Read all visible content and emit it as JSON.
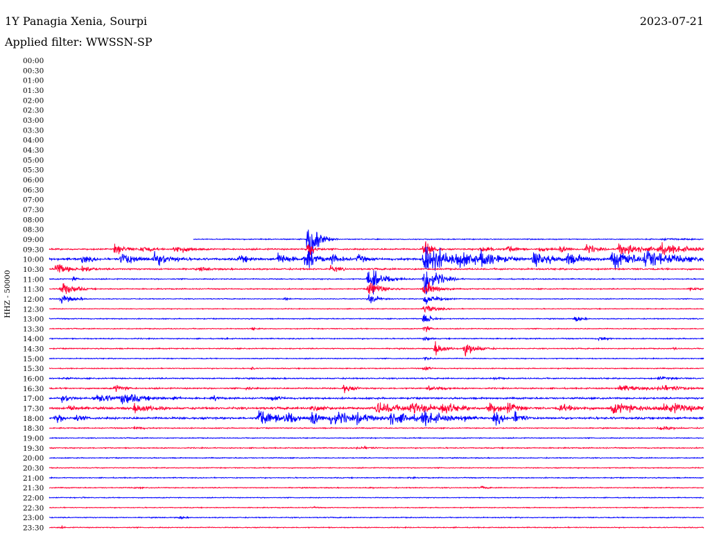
{
  "header": {
    "station": "1Y Panagia Xenia, Sourpi",
    "date": "2023-07-21",
    "filter": "Applied filter: WWSSN-SP"
  },
  "chart_data": {
    "type": "line",
    "subtype": "helicorder",
    "title": "1Y Panagia Xenia, Sourpi",
    "date": "2023-07-21",
    "filter": "WWSSN-SP",
    "ylabel": "HHZ - 50000",
    "xlabel": "",
    "row_labels": [
      "00:00",
      "00:30",
      "01:00",
      "01:30",
      "02:00",
      "02:30",
      "03:00",
      "03:30",
      "04:00",
      "04:30",
      "05:00",
      "05:30",
      "06:00",
      "06:30",
      "07:00",
      "07:30",
      "08:00",
      "08:30",
      "09:00",
      "09:30",
      "10:00",
      "10:30",
      "11:00",
      "11:30",
      "12:00",
      "12:30",
      "13:00",
      "13:30",
      "14:00",
      "14:30",
      "15:00",
      "15:30",
      "16:00",
      "16:30",
      "17:00",
      "17:30",
      "18:00",
      "18:30",
      "19:00",
      "19:30",
      "20:00",
      "20:30",
      "21:00",
      "21:30",
      "22:00",
      "22:30",
      "23:00",
      "23:30"
    ],
    "row_minutes": 30,
    "trace_colors": [
      "#0000ff",
      "#ff0033"
    ],
    "data_start_fraction": 0.22,
    "rows": [
      {
        "t": "09:00",
        "start": 0.22,
        "noise": 0.9,
        "events": [
          {
            "x": 0.396,
            "a": 60,
            "w": 0.012,
            "sym": false
          },
          {
            "x": 0.936,
            "a": 3,
            "w": 0.03
          },
          {
            "x": 0.97,
            "a": 2,
            "w": 0.03
          }
        ]
      },
      {
        "t": "09:30",
        "noise": 1.4,
        "events": [
          {
            "x": 0.1,
            "a": 12,
            "w": 0.018
          },
          {
            "x": 0.14,
            "a": 8,
            "w": 0.02
          },
          {
            "x": 0.19,
            "a": 9,
            "w": 0.03
          },
          {
            "x": 0.396,
            "a": 22,
            "w": 0.01
          },
          {
            "x": 0.573,
            "a": 22,
            "w": 0.012
          },
          {
            "x": 0.66,
            "a": 9,
            "w": 0.02
          },
          {
            "x": 0.7,
            "a": 8,
            "w": 0.02
          },
          {
            "x": 0.75,
            "a": 6,
            "w": 0.02
          },
          {
            "x": 0.78,
            "a": 7,
            "w": 0.02
          },
          {
            "x": 0.82,
            "a": 10,
            "w": 0.02
          },
          {
            "x": 0.87,
            "a": 14,
            "w": 0.04
          },
          {
            "x": 0.93,
            "a": 12,
            "w": 0.05
          }
        ]
      },
      {
        "t": "10:00",
        "noise": 2,
        "events": [
          {
            "x": 0.05,
            "a": 10,
            "w": 0.02
          },
          {
            "x": 0.11,
            "a": 14,
            "w": 0.03
          },
          {
            "x": 0.16,
            "a": 14,
            "w": 0.035
          },
          {
            "x": 0.29,
            "a": 10,
            "w": 0.02
          },
          {
            "x": 0.35,
            "a": 15,
            "w": 0.02
          },
          {
            "x": 0.39,
            "a": 20,
            "w": 0.02
          },
          {
            "x": 0.43,
            "a": 12,
            "w": 0.02
          },
          {
            "x": 0.47,
            "a": 10,
            "w": 0.02
          },
          {
            "x": 0.573,
            "a": 40,
            "w": 0.03
          },
          {
            "x": 0.62,
            "a": 20,
            "w": 0.04
          },
          {
            "x": 0.66,
            "a": 22,
            "w": 0.03
          },
          {
            "x": 0.74,
            "a": 18,
            "w": 0.03
          },
          {
            "x": 0.79,
            "a": 15,
            "w": 0.03
          },
          {
            "x": 0.86,
            "a": 20,
            "w": 0.04
          },
          {
            "x": 0.91,
            "a": 22,
            "w": 0.05
          }
        ]
      },
      {
        "t": "10:30",
        "noise": 1.5,
        "events": [
          {
            "x": 0.01,
            "a": 14,
            "w": 0.02
          },
          {
            "x": 0.05,
            "a": 8,
            "w": 0.02
          },
          {
            "x": 0.23,
            "a": 4,
            "w": 0.03
          },
          {
            "x": 0.43,
            "a": 7,
            "w": 0.02
          }
        ]
      },
      {
        "t": "11:00",
        "noise": 1,
        "events": [
          {
            "x": 0.037,
            "a": 5,
            "w": 0.01
          },
          {
            "x": 0.488,
            "a": 30,
            "w": 0.02,
            "sym": false
          },
          {
            "x": 0.573,
            "a": 30,
            "w": 0.02,
            "sym": false
          }
        ]
      },
      {
        "t": "11:30",
        "noise": 1,
        "events": [
          {
            "x": 0.018,
            "a": 16,
            "w": 0.02,
            "sym": false
          },
          {
            "x": 0.488,
            "a": 16,
            "w": 0.02
          },
          {
            "x": 0.573,
            "a": 16,
            "w": 0.02
          },
          {
            "x": 0.98,
            "a": 6,
            "w": 0.01
          }
        ]
      },
      {
        "t": "12:00",
        "noise": 0.8,
        "events": [
          {
            "x": 0.018,
            "a": 10,
            "w": 0.02
          },
          {
            "x": 0.36,
            "a": 5,
            "w": 0.006
          },
          {
            "x": 0.488,
            "a": 12,
            "w": 0.015
          },
          {
            "x": 0.573,
            "a": 14,
            "w": 0.02
          }
        ]
      },
      {
        "t": "12:30",
        "noise": 0.8,
        "events": [
          {
            "x": 0.573,
            "a": 10,
            "w": 0.02
          }
        ]
      },
      {
        "t": "13:00",
        "noise": 0.9,
        "events": [
          {
            "x": 0.573,
            "a": 16,
            "w": 0.01
          },
          {
            "x": 0.804,
            "a": 7,
            "w": 0.012
          }
        ]
      },
      {
        "t": "13:30",
        "noise": 0.9,
        "events": [
          {
            "x": 0.31,
            "a": 4,
            "w": 0.01
          },
          {
            "x": 0.573,
            "a": 8,
            "w": 0.01
          }
        ]
      },
      {
        "t": "14:00",
        "noise": 1,
        "events": [
          {
            "x": 0.27,
            "a": 3,
            "w": 0.008
          },
          {
            "x": 0.573,
            "a": 6,
            "w": 0.01
          },
          {
            "x": 0.84,
            "a": 5,
            "w": 0.015
          }
        ]
      },
      {
        "t": "14:30",
        "noise": 1,
        "events": [
          {
            "x": 0.59,
            "a": 14,
            "w": 0.015
          },
          {
            "x": 0.635,
            "a": 14,
            "w": 0.02
          },
          {
            "x": 0.955,
            "a": 4,
            "w": 0.005
          }
        ]
      },
      {
        "t": "15:00",
        "noise": 0.9,
        "events": [
          {
            "x": 0.573,
            "a": 6,
            "w": 0.01
          }
        ]
      },
      {
        "t": "15:30",
        "noise": 0.9,
        "events": [
          {
            "x": 0.31,
            "a": 5,
            "w": 0.005
          },
          {
            "x": 0.573,
            "a": 6,
            "w": 0.01
          }
        ]
      },
      {
        "t": "16:00",
        "noise": 1.2,
        "events": [
          {
            "x": 0.02,
            "a": 3,
            "w": 0.02
          },
          {
            "x": 0.68,
            "a": 3,
            "w": 0.02
          },
          {
            "x": 0.93,
            "a": 4,
            "w": 0.04
          }
        ]
      },
      {
        "t": "16:30",
        "noise": 1.3,
        "events": [
          {
            "x": 0.1,
            "a": 8,
            "w": 0.02
          },
          {
            "x": 0.3,
            "a": 4,
            "w": 0.02
          },
          {
            "x": 0.45,
            "a": 11,
            "w": 0.015
          },
          {
            "x": 0.58,
            "a": 6,
            "w": 0.03
          },
          {
            "x": 0.87,
            "a": 8,
            "w": 0.04
          },
          {
            "x": 0.93,
            "a": 7,
            "w": 0.05
          }
        ]
      },
      {
        "t": "17:00",
        "noise": 1.6,
        "events": [
          {
            "x": 0.02,
            "a": 9,
            "w": 0.02
          },
          {
            "x": 0.07,
            "a": 12,
            "w": 0.03
          },
          {
            "x": 0.11,
            "a": 14,
            "w": 0.035
          },
          {
            "x": 0.19,
            "a": 6,
            "w": 0.012
          },
          {
            "x": 0.25,
            "a": 7,
            "w": 0.012
          },
          {
            "x": 0.34,
            "a": 6,
            "w": 0.02
          }
        ]
      },
      {
        "t": "17:30",
        "noise": 2,
        "events": [
          {
            "x": 0.03,
            "a": 7,
            "w": 0.03
          },
          {
            "x": 0.13,
            "a": 10,
            "w": 0.04
          },
          {
            "x": 0.4,
            "a": 8,
            "w": 0.03
          },
          {
            "x": 0.5,
            "a": 14,
            "w": 0.04
          },
          {
            "x": 0.55,
            "a": 16,
            "w": 0.04
          },
          {
            "x": 0.6,
            "a": 14,
            "w": 0.03
          },
          {
            "x": 0.67,
            "a": 16,
            "w": 0.02
          },
          {
            "x": 0.7,
            "a": 14,
            "w": 0.02
          },
          {
            "x": 0.78,
            "a": 8,
            "w": 0.04
          },
          {
            "x": 0.86,
            "a": 12,
            "w": 0.06
          },
          {
            "x": 0.94,
            "a": 12,
            "w": 0.06
          }
        ]
      },
      {
        "t": "18:00",
        "noise": 2,
        "events": [
          {
            "x": 0.01,
            "a": 10,
            "w": 0.02
          },
          {
            "x": 0.04,
            "a": 8,
            "w": 0.02
          },
          {
            "x": 0.32,
            "a": 20,
            "w": 0.03
          },
          {
            "x": 0.36,
            "a": 18,
            "w": 0.02
          },
          {
            "x": 0.4,
            "a": 16,
            "w": 0.02
          },
          {
            "x": 0.43,
            "a": 18,
            "w": 0.03
          },
          {
            "x": 0.47,
            "a": 14,
            "w": 0.03
          },
          {
            "x": 0.52,
            "a": 16,
            "w": 0.04
          },
          {
            "x": 0.57,
            "a": 16,
            "w": 0.04
          },
          {
            "x": 0.63,
            "a": 10,
            "w": 0.02
          },
          {
            "x": 0.68,
            "a": 18,
            "w": 0.015
          },
          {
            "x": 0.71,
            "a": 14,
            "w": 0.015
          }
        ]
      },
      {
        "t": "18:30",
        "noise": 1,
        "events": [
          {
            "x": 0.13,
            "a": 4,
            "w": 0.02
          },
          {
            "x": 0.93,
            "a": 5,
            "w": 0.03
          }
        ]
      },
      {
        "t": "19:00",
        "noise": 0.9,
        "events": []
      },
      {
        "t": "19:30",
        "noise": 1,
        "events": [
          {
            "x": 0.47,
            "a": 4,
            "w": 0.03
          }
        ]
      },
      {
        "t": "20:00",
        "noise": 0.9,
        "events": []
      },
      {
        "t": "20:30",
        "noise": 0.9,
        "events": []
      },
      {
        "t": "21:00",
        "noise": 0.9,
        "events": [
          {
            "x": 0.52,
            "a": 2,
            "w": 0.01
          },
          {
            "x": 0.55,
            "a": 3,
            "w": 0.01
          }
        ]
      },
      {
        "t": "21:30",
        "noise": 0.9,
        "events": [
          {
            "x": 0.13,
            "a": 2,
            "w": 0.02
          },
          {
            "x": 0.49,
            "a": 2,
            "w": 0.02
          },
          {
            "x": 0.66,
            "a": 3,
            "w": 0.015
          }
        ]
      },
      {
        "t": "22:00",
        "noise": 0.8,
        "events": [
          {
            "x": 0.05,
            "a": 3,
            "w": 0.005
          }
        ]
      },
      {
        "t": "22:30",
        "noise": 0.8,
        "events": [
          {
            "x": 0.4,
            "a": 2,
            "w": 0.02
          }
        ]
      },
      {
        "t": "23:00",
        "noise": 0.9,
        "events": [
          {
            "x": 0.2,
            "a": 4,
            "w": 0.01
          }
        ]
      },
      {
        "t": "23:30",
        "noise": 0.9,
        "events": [
          {
            "x": 0.02,
            "a": 4,
            "w": 0.005
          }
        ]
      }
    ]
  }
}
